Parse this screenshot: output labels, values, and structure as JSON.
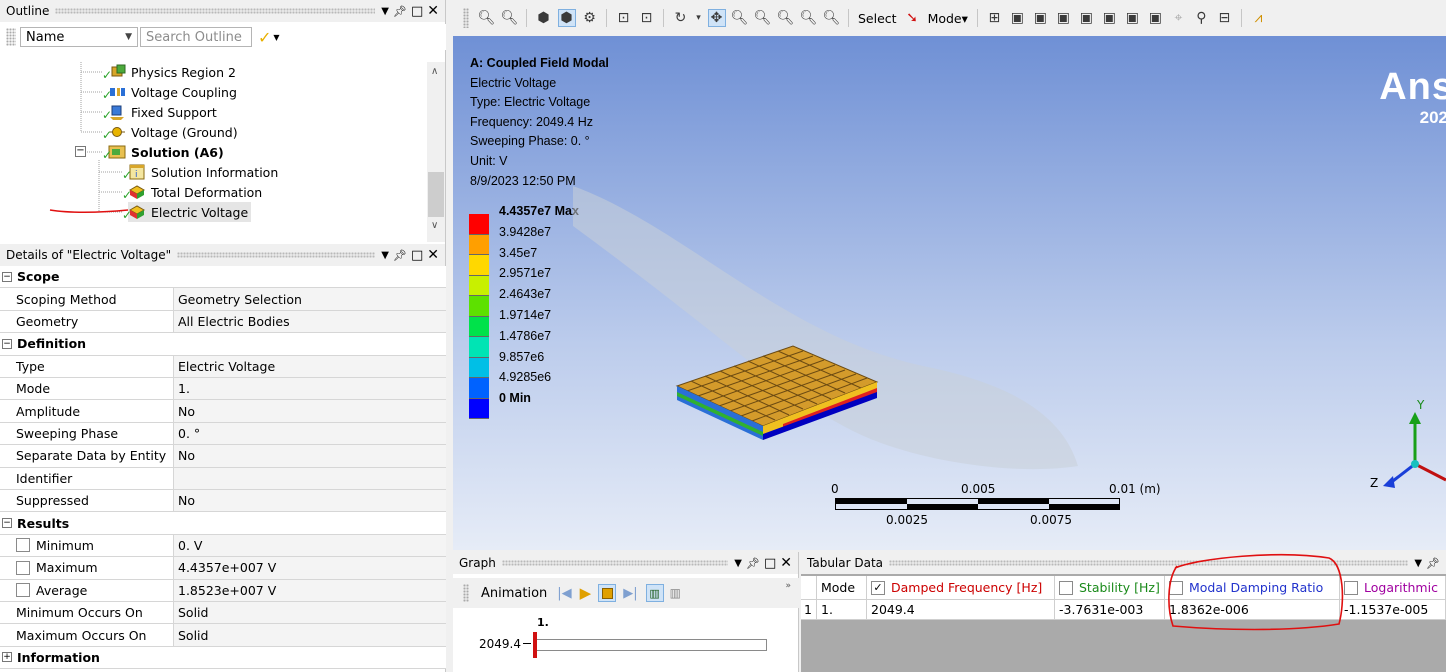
{
  "outline": {
    "title": "Outline",
    "name_combo": "Name",
    "search_placeholder": "Search Outline",
    "tree": [
      {
        "label": "Physics Region 2",
        "icon": "physics-region-icon"
      },
      {
        "label": "Voltage Coupling",
        "icon": "voltage-coupling-icon"
      },
      {
        "label": "Fixed Support",
        "icon": "fixed-support-icon"
      },
      {
        "label": "Voltage (Ground)",
        "icon": "voltage-ground-icon"
      },
      {
        "label": "Solution (A6)",
        "icon": "solution-icon"
      },
      {
        "label": "Solution Information",
        "icon": "solution-information-icon"
      },
      {
        "label": "Total Deformation",
        "icon": "result-icon"
      },
      {
        "label": "Electric Voltage",
        "icon": "result-icon"
      }
    ]
  },
  "details": {
    "title": "Details of \"Electric Voltage\"",
    "rows": [
      {
        "type": "section",
        "label": "Scope",
        "expander": "−"
      },
      {
        "type": "row",
        "key": "Scoping Method",
        "value": "Geometry Selection"
      },
      {
        "type": "row",
        "key": "Geometry",
        "value": "All Electric Bodies"
      },
      {
        "type": "section",
        "label": "Definition",
        "expander": "−"
      },
      {
        "type": "row",
        "key": "Type",
        "value": "Electric Voltage"
      },
      {
        "type": "row",
        "key": "Mode",
        "value": "1."
      },
      {
        "type": "row",
        "key": "Amplitude",
        "value": "No"
      },
      {
        "type": "row",
        "key": "Sweeping Phase",
        "value": "0. °"
      },
      {
        "type": "row",
        "key": "Separate Data by Entity",
        "value": "No"
      },
      {
        "type": "row",
        "key": "Identifier",
        "value": ""
      },
      {
        "type": "row",
        "key": "Suppressed",
        "value": "No"
      },
      {
        "type": "section",
        "label": "Results",
        "expander": "−"
      },
      {
        "type": "check",
        "key": "Minimum",
        "value": "0. V"
      },
      {
        "type": "check",
        "key": "Maximum",
        "value": "4.4357e+007 V"
      },
      {
        "type": "check",
        "key": "Average",
        "value": "1.8523e+007 V"
      },
      {
        "type": "row",
        "key": "Minimum Occurs On",
        "value": "Solid"
      },
      {
        "type": "row",
        "key": "Maximum Occurs On",
        "value": "Solid"
      },
      {
        "type": "section",
        "label": "Information",
        "expander": "+"
      }
    ]
  },
  "toolbar": {
    "select_label": "Select",
    "mode_label": "Mode▾"
  },
  "viewport": {
    "info": [
      "A: Coupled Field Modal",
      "Electric Voltage",
      "Type: Electric Voltage",
      "Frequency: 2049.4 Hz",
      "Sweeping Phase: 0. °",
      "Unit: V",
      "8/9/2023 12:50 PM"
    ],
    "legend_labels": [
      "4.4357e7 Max",
      "3.9428e7",
      "3.45e7",
      "2.9571e7",
      "2.4643e7",
      "1.9714e7",
      "1.4786e7",
      "9.857e6",
      "4.9285e6",
      "0 Min"
    ],
    "legend_colors": [
      "#ff0000",
      "#ff9f00",
      "#ffd800",
      "#c8f000",
      "#5de100",
      "#00e24a",
      "#00e4b4",
      "#00bfe6",
      "#0062ff",
      "#0000ff"
    ],
    "brand": "Ans",
    "brand_year": "202",
    "scale": {
      "top": [
        "0",
        "0.005",
        "0.01 (m)"
      ],
      "bottom": [
        "0.0025",
        "0.0075"
      ]
    },
    "triad": {
      "y": "Y",
      "z": "Z"
    }
  },
  "graph": {
    "title": "Graph",
    "animation_label": "Animation",
    "mode_marker": "1.",
    "y_value": "2049.4"
  },
  "tabular": {
    "title": "Tabular Data",
    "headers": [
      "Mode",
      "Damped Frequency [Hz]",
      "Stability [Hz]",
      "Modal Damping Ratio",
      "Logarithmic"
    ],
    "row_index": "1",
    "row": [
      "1.",
      "2049.4",
      "-3.7631e-003",
      "1.8362e-006",
      "-1.1537e-005"
    ],
    "colors": {
      "damped": "#cc0000",
      "stability": "#1a8a1a",
      "damping": "#2233cc",
      "log": "#a000a0",
      "annotation": "#e01010"
    }
  }
}
